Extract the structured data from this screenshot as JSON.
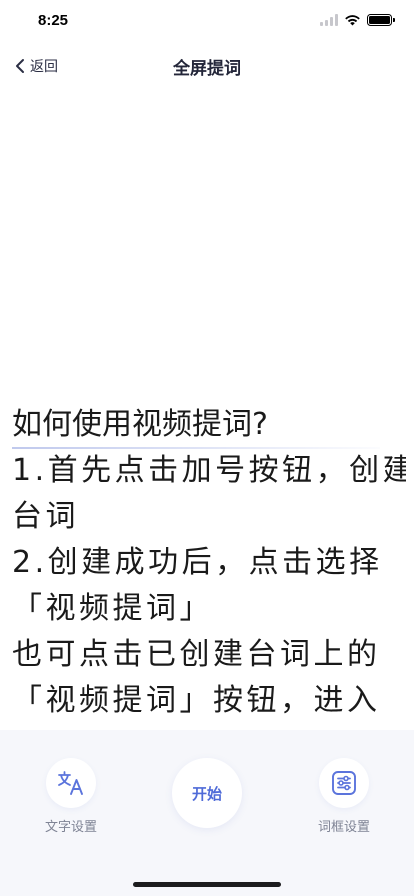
{
  "status_bar": {
    "time": "8:25",
    "battery_level": 1.0
  },
  "nav": {
    "back_label": "返回",
    "title": "全屏提词"
  },
  "prompter": {
    "heading": "如何使用视频提词?",
    "lines": [
      "1.首先点击加号按钮，创建",
      "台词",
      "2.创建成功后，点击选择",
      "「视频提词」",
      "也可点击已创建台词上的",
      "「视频提词」按钮，进入"
    ]
  },
  "toolbar": {
    "text_settings_label": "文字设置",
    "start_label": "开始",
    "frame_settings_label": "词框设置"
  },
  "colors": {
    "accent": "#4f6bd8",
    "toolbar_bg": "#f6f7fb",
    "text": "#1a1a1a"
  },
  "icons": {
    "back": "chevron-left-icon",
    "text_settings": "translate-icon",
    "frame_settings": "sliders-icon"
  }
}
